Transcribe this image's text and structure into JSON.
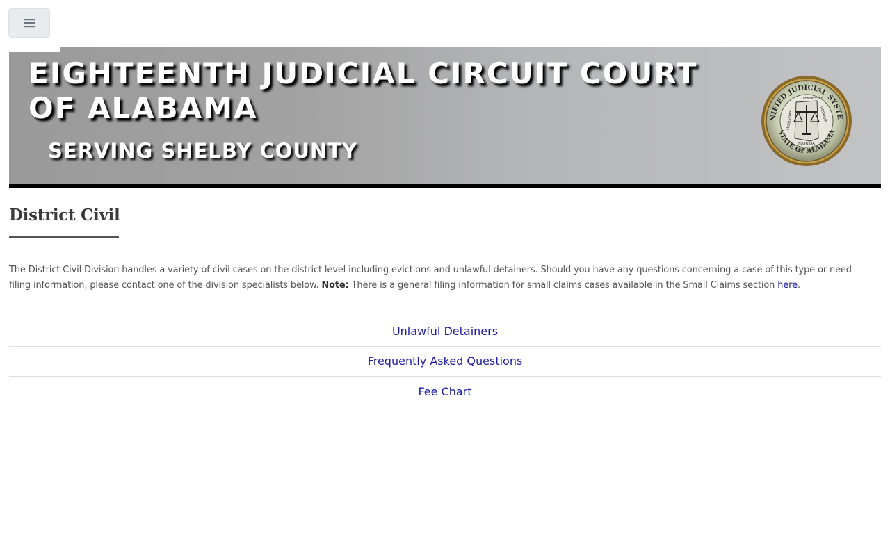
{
  "nav": {
    "menu_icon": "hamburger-icon"
  },
  "banner": {
    "title": "EIGHTEENTH JUDICIAL CIRCUIT COURT OF ALABAMA",
    "subtitle": "SERVING SHELBY COUNTY",
    "seal": {
      "top_text": "UNIFIED JUDICIAL SYSTEM",
      "bottom_text": "STATE OF ALABAMA",
      "state_labels": [
        "TENNESSEE",
        "GEORGIA",
        "MISSISSIPPI",
        "FLORIDA"
      ],
      "year": "A.D. 1971"
    }
  },
  "page": {
    "heading": "District Civil",
    "intro_text": "The District Civil Division handles a variety of civil cases on the district level including evictions and unlawful detainers. Should you have any questions concerning a case of this type or need filing information, please contact one of the division specialists below.",
    "note_label": "Note:",
    "note_text": "There is a general filing information for small claims cases available in the Small Claims section",
    "here_link": "here",
    "period": "."
  },
  "links": [
    {
      "label": "Unlawful Detainers"
    },
    {
      "label": "Frequently Asked Questions"
    },
    {
      "label": "Fee Chart"
    }
  ],
  "colors": {
    "link": "#1a1aa6",
    "banner_border": "#000000",
    "menu_bg": "#e9ecef"
  }
}
